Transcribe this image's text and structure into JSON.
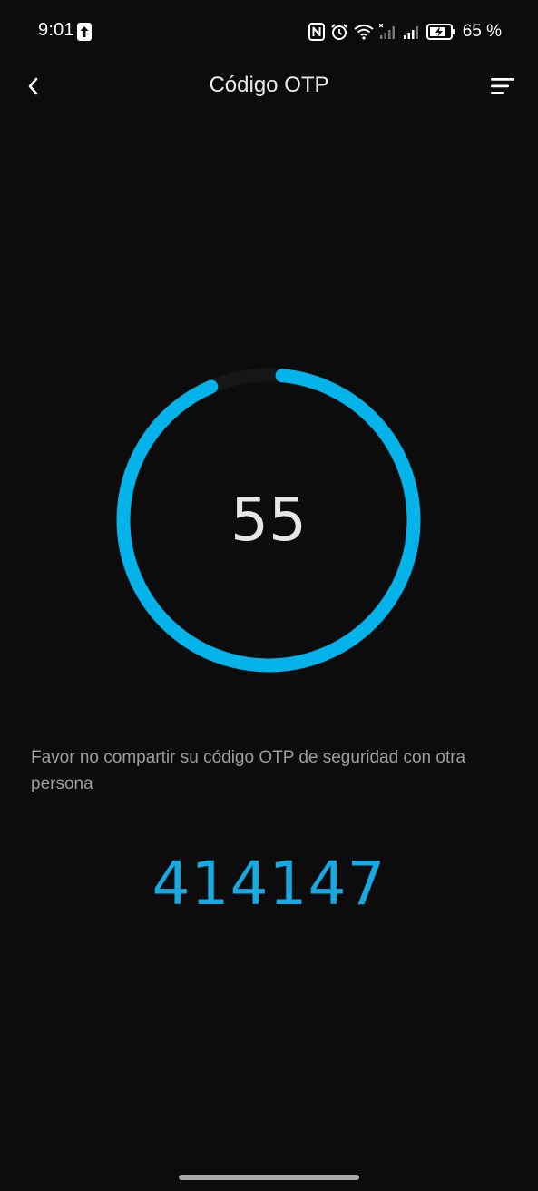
{
  "status_bar": {
    "time": "9:01",
    "battery": "65 %",
    "icons": [
      "upload-icon",
      "nfc-icon",
      "alarm-icon",
      "wifi-icon",
      "signal-icon",
      "signal-icon",
      "battery-icon"
    ]
  },
  "header": {
    "title": "Código OTP",
    "back_icon": "chevron-left-icon",
    "menu_icon": "sort-menu-icon"
  },
  "timer": {
    "seconds_left": "55",
    "progress_fraction": 0.92,
    "ring_color": "#03b3ea",
    "track_color": "#161616"
  },
  "warning": {
    "text": "Favor no compartir su código OTP de seguridad con otra persona"
  },
  "otp": {
    "code": "414147",
    "color": "#17a9e1"
  }
}
